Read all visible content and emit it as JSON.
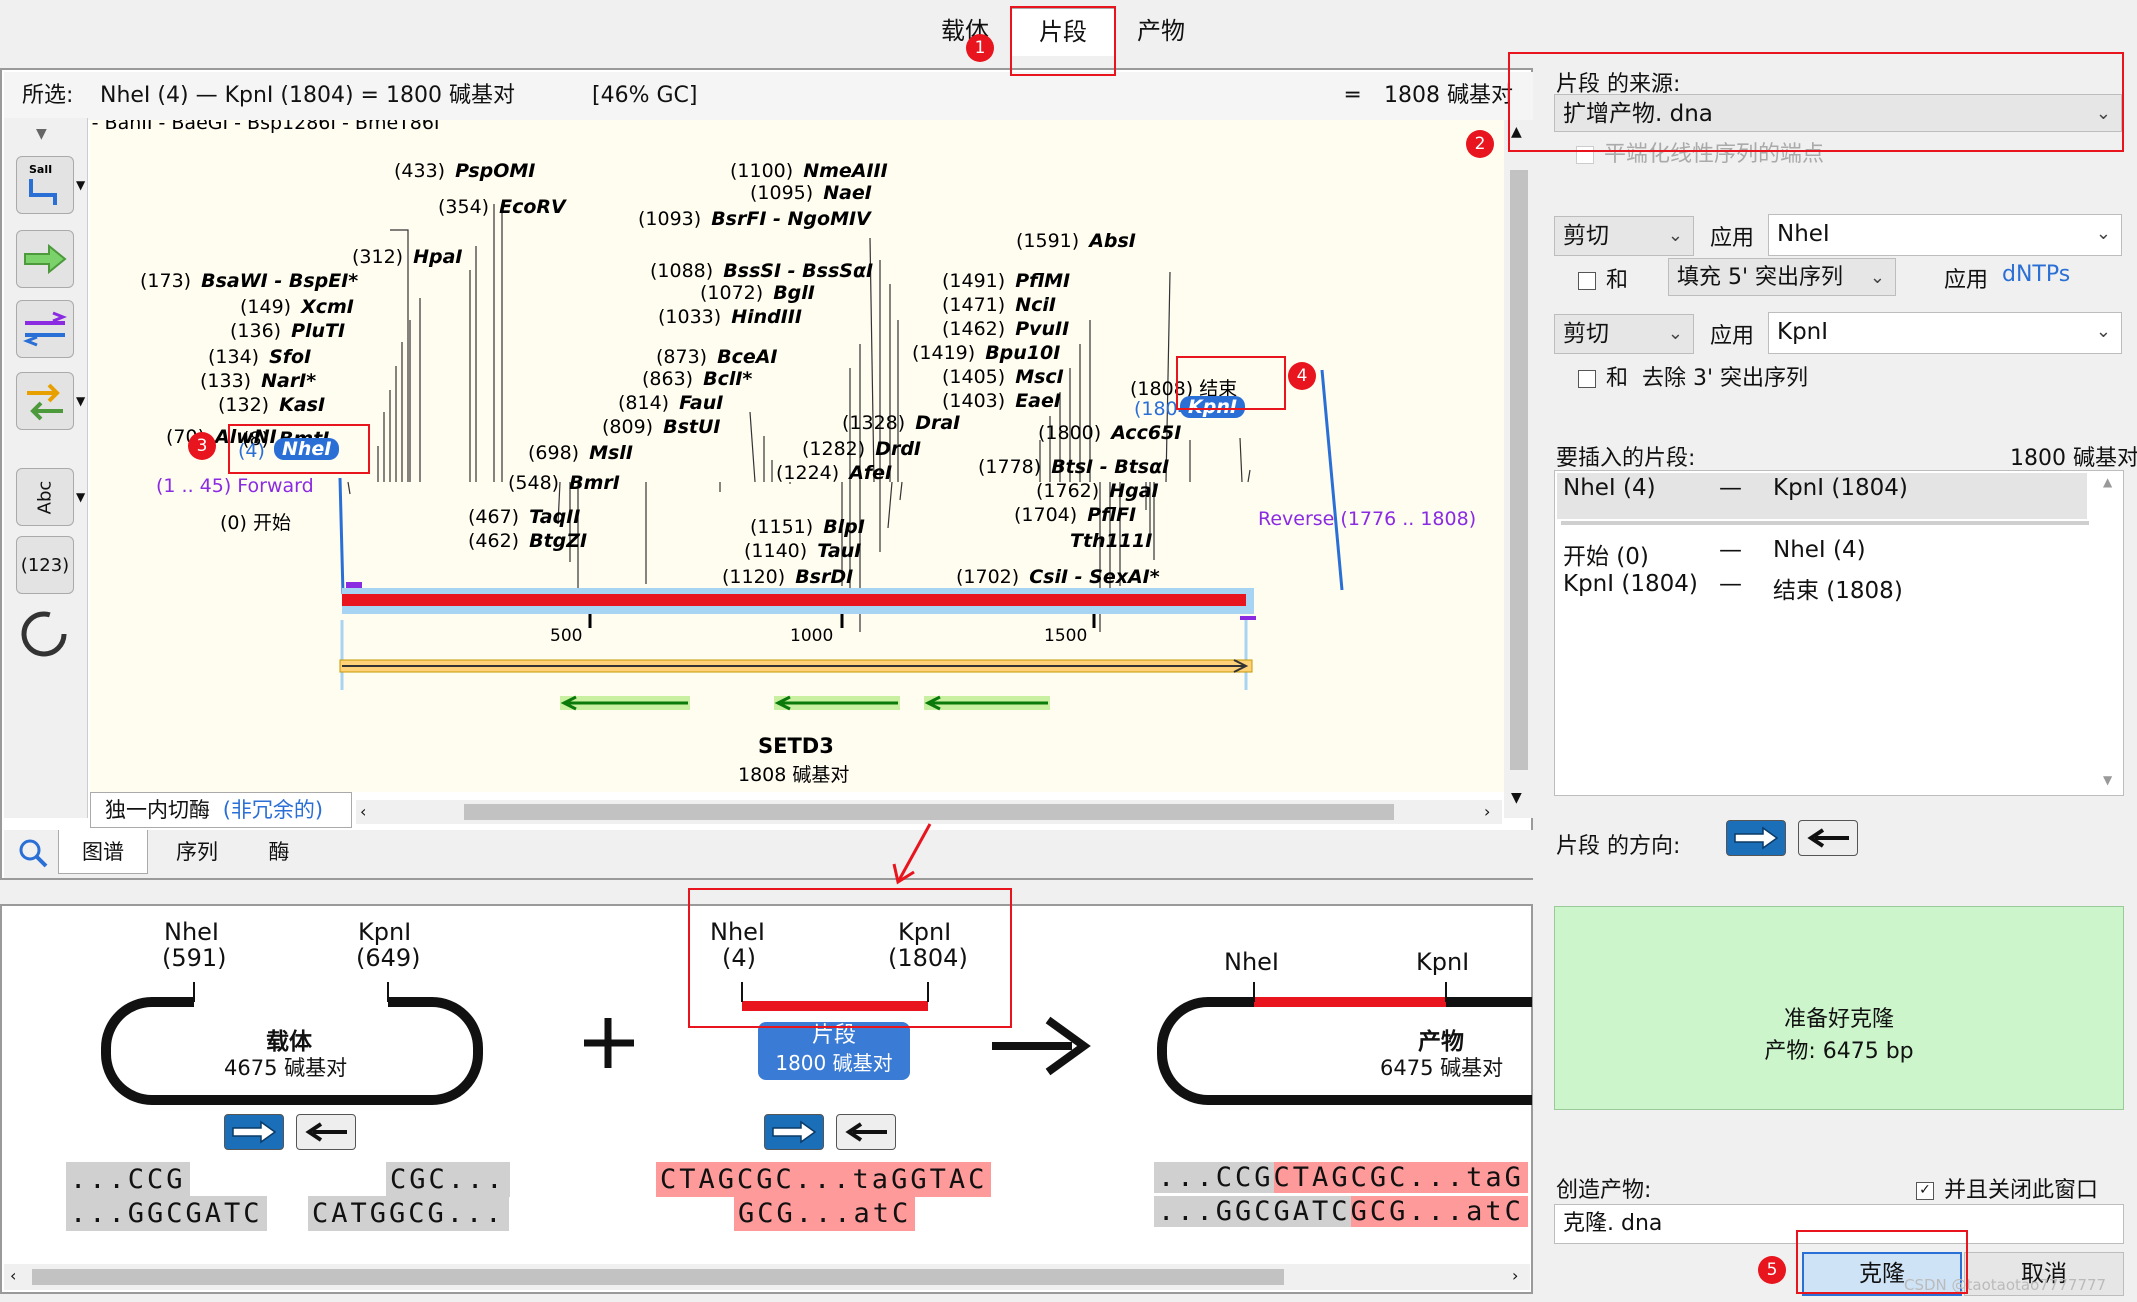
{
  "tabs": {
    "vector": "载体",
    "fragment": "片段",
    "product": "产物"
  },
  "selection_bar": {
    "prefix": "所选:",
    "range": "NheI (4)  —  KpnI (1804)  =  1800 碱基对",
    "gc": "[46% GC]",
    "total_icon": "═",
    "total": "1808 碱基对"
  },
  "map": {
    "cut_off_top": "I - BanII - BaeGI - Bsp1286I - BmeT86I",
    "left_labels": [
      {
        "pos": "(433)",
        "name": "PspOMI"
      },
      {
        "pos": "(354)",
        "name": "EcoRV"
      },
      {
        "pos": "(312)",
        "name": "HpaI"
      },
      {
        "pos": "(173)",
        "name": "BsaWI - BspEI*"
      },
      {
        "pos": "(149)",
        "name": "XcmI"
      },
      {
        "pos": "(136)",
        "name": "PluTI"
      },
      {
        "pos": "(134)",
        "name": "SfoI"
      },
      {
        "pos": "(133)",
        "name": "NarI*"
      },
      {
        "pos": "(132)",
        "name": "KasI"
      },
      {
        "pos": "(70)",
        "name": "AlwNI"
      },
      {
        "pos": "(8)",
        "name": "BmtI"
      }
    ],
    "nhei": {
      "pos": "(4)",
      "name": "NheI"
    },
    "forward": "(1 .. 45)  Forward",
    "start": "(0)  开始",
    "mid_labels": [
      {
        "pos": "(1100)",
        "name": "NmeAIII"
      },
      {
        "pos": "(1095)",
        "name": "NaeI"
      },
      {
        "pos": "(1093)",
        "name": "BsrFI - NgoMIV"
      },
      {
        "pos": "(1088)",
        "name": "BssSI - BssSαI"
      },
      {
        "pos": "(1072)",
        "name": "BglI"
      },
      {
        "pos": "(1033)",
        "name": "HindIII"
      },
      {
        "pos": "(873)",
        "name": "BceAI"
      },
      {
        "pos": "(863)",
        "name": "BclI*"
      },
      {
        "pos": "(814)",
        "name": "FauI"
      },
      {
        "pos": "(809)",
        "name": "BstUI"
      },
      {
        "pos": "(698)",
        "name": "MslI"
      },
      {
        "pos": "(548)",
        "name": "BmrI"
      },
      {
        "pos": "(467)",
        "name": "TaqII"
      },
      {
        "pos": "(462)",
        "name": "BtgZI"
      },
      {
        "pos": "(1328)",
        "name": "DraI"
      },
      {
        "pos": "(1282)",
        "name": "DrdI"
      },
      {
        "pos": "(1224)",
        "name": "AfeI"
      },
      {
        "pos": "(1151)",
        "name": "BlpI"
      },
      {
        "pos": "(1140)",
        "name": "TauI"
      },
      {
        "pos": "(1120)",
        "name": "BsrDI"
      }
    ],
    "right_labels": [
      {
        "pos": "(1591)",
        "name": "AbsI"
      },
      {
        "pos": "(1491)",
        "name": "PflMI"
      },
      {
        "pos": "(1471)",
        "name": "NciI"
      },
      {
        "pos": "(1462)",
        "name": "PvuII"
      },
      {
        "pos": "(1419)",
        "name": "Bpu10I"
      },
      {
        "pos": "(1405)",
        "name": "MscI"
      },
      {
        "pos": "(1403)",
        "name": "EaeI"
      },
      {
        "pos": "(1800)",
        "name": "Acc65I"
      },
      {
        "pos": "(1778)",
        "name": "BtsI - BtsαI"
      },
      {
        "pos": "(1762)",
        "name": "HgaI"
      },
      {
        "pos": "(1704)",
        "name": "PflFI"
      },
      {
        "pos": "",
        "name": "Tth111I"
      },
      {
        "pos": "(1702)",
        "name": "CsiI - SexAI*"
      }
    ],
    "end": "(1808)  结束",
    "kpni": {
      "pos": "(1804)",
      "name": "KpnI"
    },
    "reverse": "Reverse  (1776 .. 1808)",
    "ticks": [
      "500",
      "1000",
      "1500"
    ],
    "seq_name": "SETD3",
    "seq_len": "1808 碱基对"
  },
  "unique_cutters": {
    "label": "独一内切酶",
    "link": "(非冗余的)"
  },
  "view_tabs": {
    "map": "图谱",
    "sequence": "序列",
    "enzymes": "酶"
  },
  "toolbar": {
    "sali": "SalI",
    "abc": "Abc",
    "num": "(123)"
  },
  "preview": {
    "vector": {
      "site1": "NheI",
      "pos1": "(591)",
      "site2": "KpnI",
      "pos2": "(649)",
      "name": "载体",
      "len": "4675 碱基对",
      "seq_left_top": "...CCG",
      "seq_left_bot": "...GGCGATC",
      "seq_right_top": "CGC...",
      "seq_right_bot": "CATGGCG..."
    },
    "plus": "+",
    "fragment": {
      "site1": "NheI",
      "pos1": "(4)",
      "site2": "KpnI",
      "pos2": "(1804)",
      "name": "片段",
      "len": "1800 碱基对",
      "seq_top": "CTAGCGC...taGGTAC",
      "seq_bot": "GCG...atC"
    },
    "product": {
      "site1": "NheI",
      "site2": "KpnI",
      "name": "产物",
      "len": "6475 碱基对",
      "seq_top_grey": "...CCG",
      "seq_top_red": "CTAGCGC...taG",
      "seq_bot_grey": "...GGCGATC",
      "seq_bot_red": "GCG...atC"
    }
  },
  "right": {
    "source_label": "片段 的来源:",
    "source_value": "扩增产物. dna",
    "blunt_label": "平端化线性序列的端点",
    "cut1": {
      "mode": "剪切",
      "apply": "应用",
      "enzyme": "NheI",
      "and": "和",
      "fill": "填充 5' 突出序列",
      "apply2": "应用",
      "dntps": "dNTPs"
    },
    "cut2": {
      "mode": "剪切",
      "apply": "应用",
      "enzyme": "KpnI",
      "and": "和",
      "remove": "去除 3' 突出序列"
    },
    "insert_label": "要插入的片段:",
    "insert_len": "1800 碱基对",
    "insert_rows": [
      {
        "a": "NheI (4)",
        "dash": "—",
        "b": "KpnI (1804)"
      },
      {
        "a": "开始 (0)",
        "dash": "—",
        "b": "NheI (4)"
      },
      {
        "a": "KpnI (1804)",
        "dash": "—",
        "b": "结束 (1808)"
      }
    ],
    "orient_label": "片段 的方向:",
    "status_line1": "准备好克隆",
    "status_line2": "产物:  6475 bp",
    "create_label": "创造产物:",
    "close_label": "并且关闭此窗口",
    "filename": "克隆. dna",
    "clone_btn": "克隆",
    "cancel_btn": "取消",
    "watermark": "CSDN @taotaotao7777777"
  },
  "annotations": [
    "1",
    "2",
    "3",
    "4",
    "5"
  ],
  "colors": {
    "red": "#e8141e",
    "blue_tag": "#2a6fd6",
    "purple": "#8a2be2",
    "map_bg": "#fffcf0",
    "ready_bg": "#ccf5cc"
  }
}
